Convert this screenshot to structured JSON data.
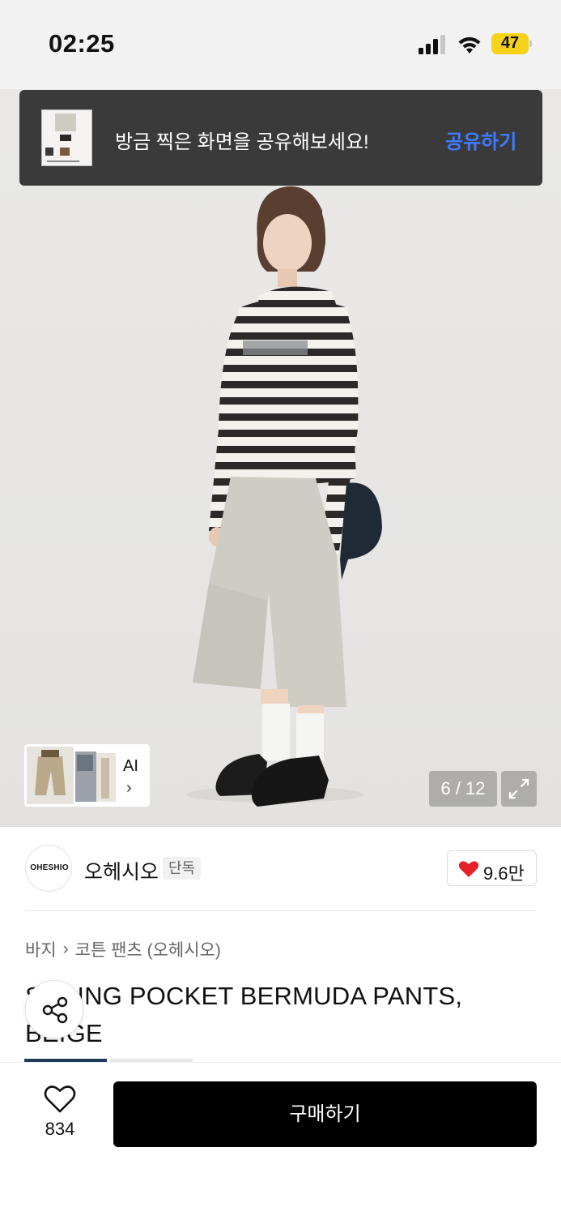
{
  "status_bar": {
    "time": "02:25",
    "battery": "47"
  },
  "share_toast": {
    "message": "방금 찍은 화면을 공유해보세요!",
    "action": "공유하기"
  },
  "gallery": {
    "ai_label": "AI",
    "ai_chevron": "›",
    "counter": "6 / 12",
    "current": 6,
    "total": 12
  },
  "brand": {
    "logo_text": "OHESHIO",
    "name": "오헤시오",
    "badge": "단독",
    "likes": "9.6만"
  },
  "breadcrumb": {
    "items": [
      "바지",
      "코튼 팬츠 (오헤시오)"
    ],
    "separator": "›"
  },
  "product": {
    "title": "SPRING POCKET BERMUDA PANTS, BEIGE"
  },
  "bottom_bar": {
    "wish_count": "834",
    "buy_label": "구매하기"
  },
  "colors": {
    "toast_bg": "#3a3a3a",
    "toast_action": "#3d7bff",
    "battery": "#f7d21a",
    "heart": "#e8202a",
    "buy_button": "#000000"
  }
}
